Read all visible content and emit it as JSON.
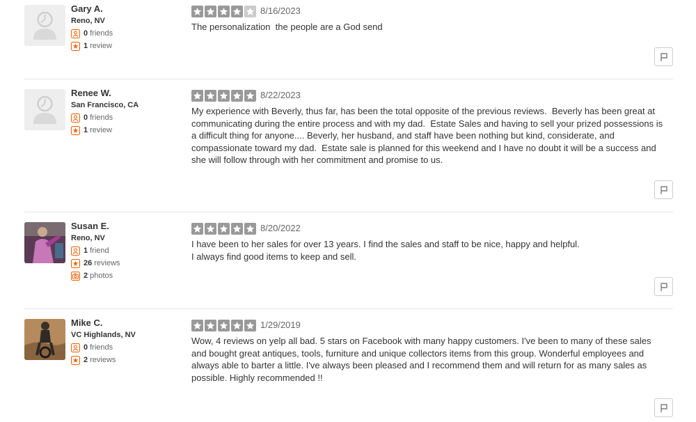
{
  "colors": {
    "star_filled": "#999999",
    "star_empty": "#cccccc",
    "stat_icon": "#f15c00"
  },
  "reviews": [
    {
      "name": "Gary A.",
      "location": "Reno, NV",
      "avatar": "default-avatar",
      "friends_count": "0",
      "friends_label": "friends",
      "reviews_count": "1",
      "reviews_label": "review",
      "photos_count": "",
      "photos_label": "",
      "rating": 4,
      "date": "8/16/2023",
      "text": "The personalization  the people are a God send"
    },
    {
      "name": "Renee W.",
      "location": "San Francisco, CA",
      "avatar": "default-avatar",
      "friends_count": "0",
      "friends_label": "friends",
      "reviews_count": "1",
      "reviews_label": "review",
      "photos_count": "",
      "photos_label": "",
      "rating": 5,
      "date": "8/22/2023",
      "text": "My experience with Beverly, thus far, has been the total opposite of the previous reviews.  Beverly has been great at communicating during the entire process and with my dad.  Estate Sales and having to sell your prized possessions is a difficult thing for anyone.... Beverly, her husband, and staff have been nothing but kind, considerate, and compassionate toward my dad.  Estate sale is planned for this weekend and I have no doubt it will be a success and she will follow through with her commitment and promise to us."
    },
    {
      "name": "Susan E.",
      "location": "Reno, NV",
      "avatar": "user-photo",
      "friends_count": "1",
      "friends_label": "friend",
      "reviews_count": "26",
      "reviews_label": "reviews",
      "photos_count": "2",
      "photos_label": "photos",
      "rating": 5,
      "date": "8/20/2022",
      "text": "I have been to her sales for over 13 years. I find the sales and staff to be nice, happy and helpful.\nI always find good items to keep and sell."
    },
    {
      "name": "Mike C.",
      "location": "VC Highlands, NV",
      "avatar": "user-photo",
      "friends_count": "0",
      "friends_label": "friends",
      "reviews_count": "2",
      "reviews_label": "reviews",
      "photos_count": "",
      "photos_label": "",
      "rating": 5,
      "date": "1/29/2019",
      "text": "Wow, 4 reviews on yelp all bad. 5 stars on Facebook with many happy customers. I've been to many of these sales and bought great antiques, tools, furniture and unique collectors items from this group. Wonderful employees and always able to barter a little. I've always been pleased and I recommend them and will return for as many sales as possible. Highly recommended !!"
    }
  ]
}
